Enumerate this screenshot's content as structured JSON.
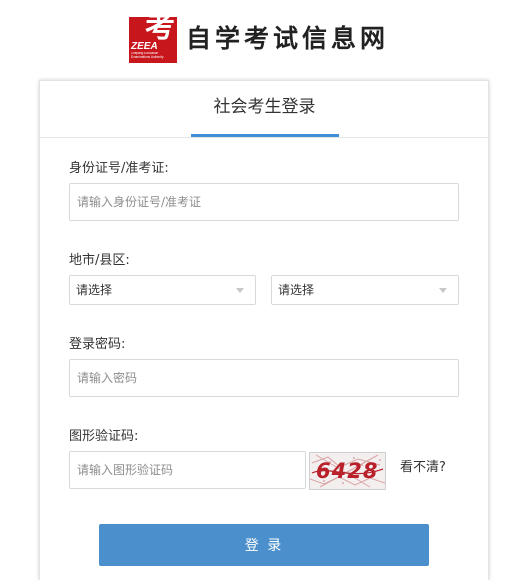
{
  "header": {
    "logo_glyph": "考",
    "logo_text": "ZEEA",
    "logo_subtext_1": "Zhejiang Education",
    "logo_subtext_2": "Examinations Authority",
    "site_title": "自学考试信息网"
  },
  "tab": {
    "label": "社会考生登录"
  },
  "form": {
    "id_label": "身份证号/准考证:",
    "id_placeholder": "请输入身份证号/准考证",
    "region_label": "地市/县区:",
    "city_select": "请选择",
    "county_select": "请选择",
    "password_label": "登录密码:",
    "password_placeholder": "请输入密码",
    "captcha_label": "图形验证码:",
    "captcha_placeholder": "请输入图形验证码",
    "captcha_code": "6428",
    "refresh_text": "看不清?",
    "login_button": "登 录"
  },
  "colors": {
    "logo_red": "#c8161d",
    "accent_blue": "#3f8ed5",
    "button_blue": "#4b90cc",
    "captcha_red": "#b8202a"
  }
}
